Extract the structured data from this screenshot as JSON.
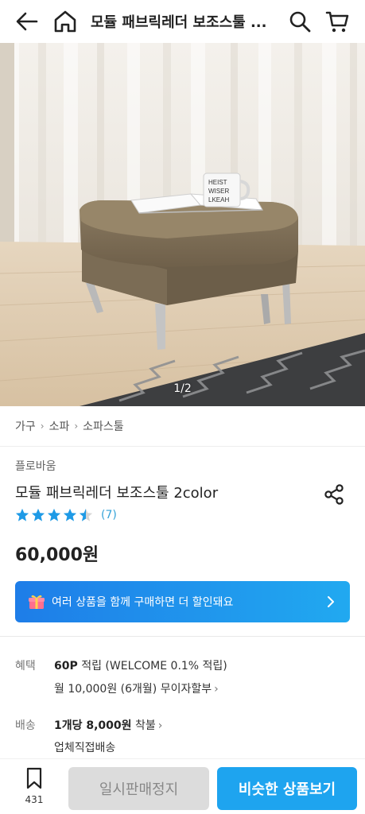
{
  "header": {
    "title": "모듈 패브릭레더 보조스툴 ...",
    "icons": [
      "back-arrow-icon",
      "home-icon",
      "search-icon",
      "cart-icon"
    ]
  },
  "hero": {
    "pager": "1/2",
    "mug_text": "HEIST\nWISER\nLKEAH"
  },
  "breadcrumb": {
    "items": [
      "가구",
      "소파",
      "소파스툴"
    ]
  },
  "product": {
    "brand": "플로바움",
    "name": "모듈 패브릭레더 보조스툴 2color",
    "rating": 4.5,
    "review_count": "(7)",
    "price": "60,000원"
  },
  "promo": {
    "text": "여러 상품을 함께 구매하면 더 할인돼요"
  },
  "benefit": {
    "label": "혜택",
    "points": "60P",
    "points_suffix": "적립 (WELCOME 0.1% 적립)",
    "installment": "월 10,000원 (6개월) 무이자할부"
  },
  "shipping": {
    "label": "배송",
    "fee": "1개당 8,000원",
    "fee_suffix": "착불",
    "method": "업체직접배송"
  },
  "bottom": {
    "bookmark_count": "431",
    "soldout_label": "일시판매정지",
    "similar_label": "비슷한 상품보기"
  },
  "colors": {
    "accent": "#1ea4ef",
    "promo_start": "#1e7de8",
    "star": "#1e9ae6"
  }
}
